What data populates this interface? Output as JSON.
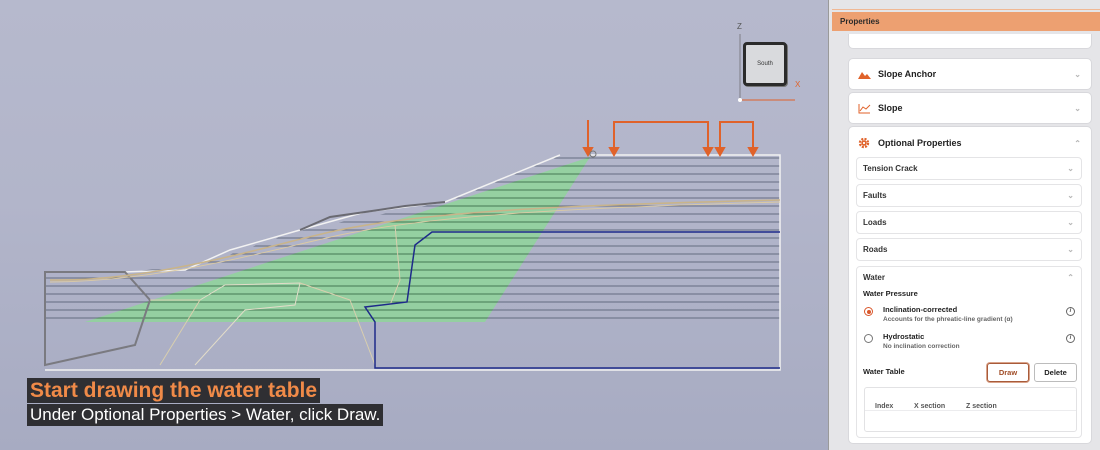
{
  "viewport": {
    "nav_cube": {
      "face_label": "South",
      "axis_z": "Z",
      "axis_x": "X"
    },
    "caption": {
      "title": "Start drawing the water table",
      "subtitle": "Under Optional Properties > Water, click Draw."
    },
    "colors": {
      "load": "#e0622a",
      "water_fill": "#8fd59a",
      "water_line": "#1e2a8a",
      "slope_outline": "#f2f2f2"
    }
  },
  "panel": {
    "title": "Properties",
    "cards": {
      "slope_anchor": {
        "label": "Slope Anchor",
        "icon": "terrain-icon"
      },
      "slope": {
        "label": "Slope",
        "icon": "line-chart-icon"
      },
      "optional": {
        "label": "Optional Properties",
        "icon": "gear-icon"
      }
    },
    "sections": {
      "tension_crack": "Tension Crack",
      "faults": "Faults",
      "loads": "Loads",
      "roads": "Roads",
      "water": "Water"
    },
    "water": {
      "pressure_label": "Water Pressure",
      "options": [
        {
          "label": "Inclination-corrected",
          "desc": "Accounts for the phreatic-line gradient (α)",
          "selected": true
        },
        {
          "label": "Hydrostatic",
          "desc": "No inclination correction",
          "selected": false
        }
      ],
      "table_label": "Water Table",
      "draw_label": "Draw",
      "delete_label": "Delete",
      "columns": [
        "Index",
        "X section",
        "Z section"
      ]
    },
    "accent": "#eda071"
  }
}
